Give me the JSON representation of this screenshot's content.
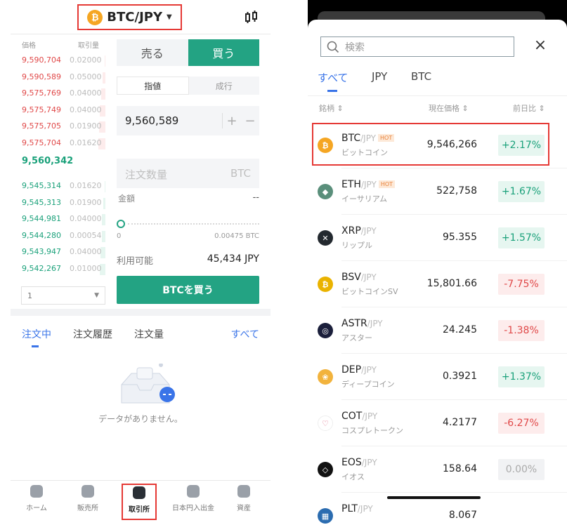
{
  "left": {
    "pair": {
      "symbol": "BTC/JPY",
      "coin_glyph": "₿",
      "coin_color": "#f5a623"
    },
    "orderbook": {
      "price_header": "価格",
      "qty_header": "取引量",
      "asks": [
        {
          "price": "9,590,704",
          "qty": "0.02000",
          "depth": 0.1
        },
        {
          "price": "9,590,589",
          "qty": "0.05000",
          "depth": 0.25
        },
        {
          "price": "9,575,769",
          "qty": "0.04000",
          "depth": 0.4
        },
        {
          "price": "9,575,749",
          "qty": "0.04000",
          "depth": 0.55
        },
        {
          "price": "9,575,705",
          "qty": "0.01900",
          "depth": 0.62
        },
        {
          "price": "9,575,704",
          "qty": "0.01620",
          "depth": 0.7
        }
      ],
      "mid_price": "9,560,342",
      "bids": [
        {
          "price": "9,545,314",
          "qty": "0.01620",
          "depth": 0.08
        },
        {
          "price": "9,545,313",
          "qty": "0.01900",
          "depth": 0.18
        },
        {
          "price": "9,544,981",
          "qty": "0.04000",
          "depth": 0.35
        },
        {
          "price": "9,544,280",
          "qty": "0.00054",
          "depth": 0.36
        },
        {
          "price": "9,543,947",
          "qty": "0.04000",
          "depth": 0.52
        },
        {
          "price": "9,542,267",
          "qty": "0.01000",
          "depth": 0.58
        }
      ],
      "depth_select": "1"
    },
    "trade": {
      "sell_label": "売る",
      "buy_label": "買う",
      "limit_label": "指値",
      "market_label": "成行",
      "price_value": "9,560,589",
      "plus": "+",
      "minus": "−",
      "qty_placeholder": "注文数量",
      "qty_unit": "BTC",
      "amount_label": "金額",
      "amount_value": "--",
      "slider_min": "0",
      "slider_max": "0.00475 BTC",
      "available_label": "利用可能",
      "available_value": "45,434 JPY",
      "buy_button": "BTCを買う"
    },
    "orders": {
      "tab_open": "注文中",
      "tab_history": "注文履歴",
      "tab_volume": "注文量",
      "all_label": "すべて",
      "empty_text": "データがありません。"
    },
    "nav": [
      {
        "label": "ホーム",
        "icon": "home-icon"
      },
      {
        "label": "販売所",
        "icon": "store-icon"
      },
      {
        "label": "取引所",
        "icon": "exchange-icon"
      },
      {
        "label": "日本円入出金",
        "icon": "deposit-icon"
      },
      {
        "label": "資産",
        "icon": "wallet-icon"
      }
    ],
    "active_nav": "取引所"
  },
  "market": {
    "search_placeholder": "検索",
    "tabs": [
      "すべて",
      "JPY",
      "BTC"
    ],
    "headers": {
      "name": "銘柄 ⇕",
      "price": "現在価格 ⇕",
      "change": "前日比 ⇕"
    },
    "rows": [
      {
        "sym": "BTC",
        "quote": "/JPY",
        "hot": "HOT",
        "name": "ビットコイン",
        "price": "9,546,266",
        "change": "+2.17%",
        "dir": "up",
        "color": "#f5a623",
        "glyph": "₿"
      },
      {
        "sym": "ETH",
        "quote": "/JPY",
        "hot": "HOT",
        "name": "イーサリアム",
        "price": "522,758",
        "change": "+1.67%",
        "dir": "up",
        "color": "#5a8f7b",
        "glyph": "◆"
      },
      {
        "sym": "XRP",
        "quote": "/JPY",
        "hot": "",
        "name": "リップル",
        "price": "95.355",
        "change": "+1.57%",
        "dir": "up",
        "color": "#23292f",
        "glyph": "✕"
      },
      {
        "sym": "BSV",
        "quote": "/JPY",
        "hot": "",
        "name": "ビットコインSV",
        "price": "15,801.66",
        "change": "-7.75%",
        "dir": "down",
        "color": "#eab300",
        "glyph": "₿"
      },
      {
        "sym": "ASTR",
        "quote": "/JPY",
        "hot": "",
        "name": "アスター",
        "price": "24.245",
        "change": "-1.38%",
        "dir": "down",
        "color": "#1b1f3b",
        "glyph": "◎"
      },
      {
        "sym": "DEP",
        "quote": "/JPY",
        "hot": "",
        "name": "ディープコイン",
        "price": "0.3921",
        "change": "+1.37%",
        "dir": "up",
        "color": "#f2b33d",
        "glyph": "❀"
      },
      {
        "sym": "COT",
        "quote": "/JPY",
        "hot": "",
        "name": "コスプレトークン",
        "price": "4.2177",
        "change": "-6.27%",
        "dir": "down",
        "color": "#ffffff",
        "glyph": "♡"
      },
      {
        "sym": "EOS",
        "quote": "/JPY",
        "hot": "",
        "name": "イオス",
        "price": "158.64",
        "change": "0.00%",
        "dir": "flat",
        "color": "#111111",
        "glyph": "◇"
      },
      {
        "sym": "PLT",
        "quote": "/JPY",
        "hot": "",
        "name": "",
        "price": "8.067",
        "change": "",
        "dir": "flat",
        "color": "#2b6cb0",
        "glyph": "▦"
      }
    ]
  },
  "colors": {
    "accent_green": "#23a383",
    "accent_blue": "#3a74e8",
    "ask_red": "#e04848",
    "highlight": "#e53935"
  }
}
